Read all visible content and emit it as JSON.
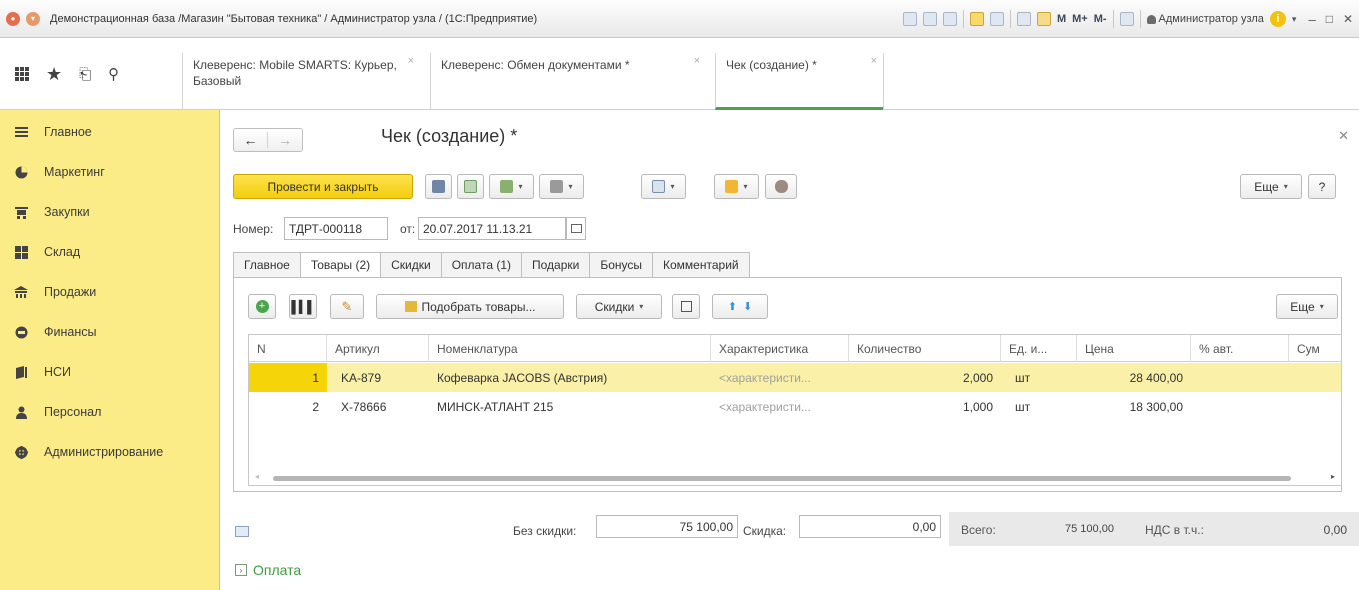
{
  "window": {
    "title": "Демонстрационная база /Магазин \"Бытовая техника\" / Администратор узла / (1С:Предприятие)",
    "user": "Администратор узла",
    "m_labels": [
      "M",
      "M+",
      "M-"
    ]
  },
  "open_tabs": [
    {
      "label": "Клеверенс: Mobile SMARTS: Курьер, Базовый",
      "active": false
    },
    {
      "label": "Клеверенс: Обмен документами *",
      "active": false
    },
    {
      "label": "Чек (создание) *",
      "active": true
    }
  ],
  "sidebar": {
    "items": [
      {
        "label": "Главное",
        "icon": "menu-lines-icon"
      },
      {
        "label": "Маркетинг",
        "icon": "pie-chart-icon"
      },
      {
        "label": "Закупки",
        "icon": "cart-icon"
      },
      {
        "label": "Склад",
        "icon": "warehouse-icon"
      },
      {
        "label": "Продажи",
        "icon": "store-icon"
      },
      {
        "label": "Финансы",
        "icon": "coin-icon"
      },
      {
        "label": "НСИ",
        "icon": "book-icon"
      },
      {
        "label": "Персонал",
        "icon": "person-icon"
      },
      {
        "label": "Администрирование",
        "icon": "gear-icon"
      }
    ]
  },
  "form": {
    "title": "Чек (создание) *",
    "post_and_close": "Провести и закрыть",
    "more": "Еще",
    "help": "?",
    "number_label": "Номер:",
    "number_value": "ТДРТ-000118",
    "date_label": "от:",
    "date_value": "20.07.2017 11.13.21"
  },
  "tabs": [
    {
      "label": "Главное"
    },
    {
      "label": "Товары (2)",
      "active": true
    },
    {
      "label": "Скидки"
    },
    {
      "label": "Оплата (1)"
    },
    {
      "label": "Подарки"
    },
    {
      "label": "Бонусы"
    },
    {
      "label": "Комментарий"
    }
  ],
  "goods": {
    "pick_button": "Подобрать товары...",
    "discounts_button": "Скидки",
    "more": "Еще",
    "columns": [
      "N",
      "Артикул",
      "Номенклатура",
      "Характеристика",
      "Количество",
      "Ед. и...",
      "Цена",
      "% авт.",
      "Сум"
    ],
    "rows": [
      {
        "n": "1",
        "article": "KA-879",
        "name": "Кофеварка JACOBS (Австрия)",
        "char": "<характеристи...",
        "qty": "2,000",
        "unit": "шт",
        "price": "28 400,00",
        "auto": "",
        "sum": ""
      },
      {
        "n": "2",
        "article": "X-78666",
        "name": "МИНСК-АТЛАНТ 215",
        "char": "<характеристи...",
        "qty": "1,000",
        "unit": "шт",
        "price": "18 300,00",
        "auto": "",
        "sum": ""
      }
    ]
  },
  "totals": {
    "without_discount_label": "Без скидки:",
    "without_discount_value": "75 100,00",
    "discount_label": "Скидка:",
    "discount_value": "0,00",
    "total_label": "Всего:",
    "total_value": "75 100,00",
    "vat_label": "НДС в т.ч.:",
    "vat_value": "0,00"
  },
  "payment_section": "Оплата"
}
